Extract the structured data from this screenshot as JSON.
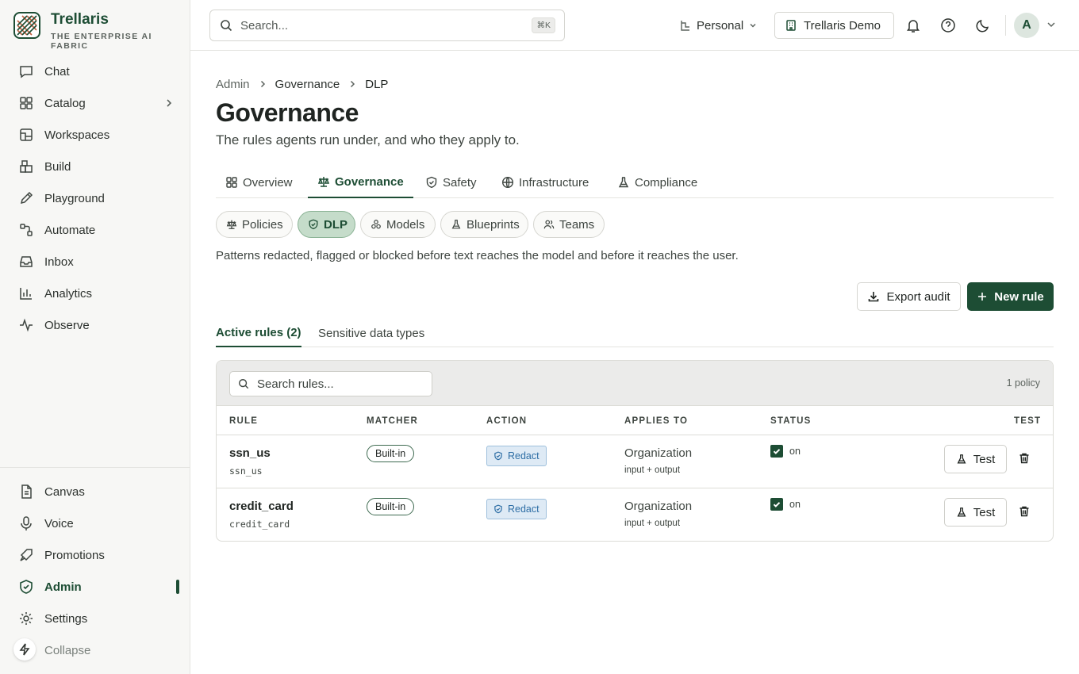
{
  "brand": {
    "name": "Trellaris",
    "tagline": "THE ENTERPRISE AI FABRIC",
    "accent": "#1d4d34"
  },
  "sidebar": {
    "items": [
      {
        "label": "Chat",
        "icon": "chat-bubble-icon"
      },
      {
        "label": "Catalog",
        "icon": "grid-icon",
        "has_submenu": true
      },
      {
        "label": "Workspaces",
        "icon": "workspaces-icon"
      },
      {
        "label": "Build",
        "icon": "blocks-icon"
      },
      {
        "label": "Playground",
        "icon": "pencil-icon"
      },
      {
        "label": "Automate",
        "icon": "workflow-icon"
      },
      {
        "label": "Inbox",
        "icon": "inbox-icon"
      },
      {
        "label": "Analytics",
        "icon": "bar-chart-icon"
      },
      {
        "label": "Observe",
        "icon": "activity-icon"
      }
    ],
    "bottom_items": [
      {
        "label": "Canvas",
        "icon": "document-icon"
      },
      {
        "label": "Voice",
        "icon": "microphone-icon"
      },
      {
        "label": "Promotions",
        "icon": "rocket-icon"
      },
      {
        "label": "Admin",
        "icon": "shield-icon",
        "active": true
      },
      {
        "label": "Settings",
        "icon": "gear-icon"
      },
      {
        "label": "Collapse",
        "icon": "bolt-icon"
      }
    ]
  },
  "topbar": {
    "search_placeholder": "Search...",
    "search_shortcut": "⌘K",
    "workspace_label": "Personal",
    "org_label": "Trellaris Demo",
    "avatar_initial": "A"
  },
  "breadcrumb": [
    "Admin",
    "Governance",
    "DLP"
  ],
  "page": {
    "title": "Governance",
    "subtitle": "The rules agents run under, and who they apply to."
  },
  "tabs": [
    {
      "label": "Overview",
      "icon": "grid-icon"
    },
    {
      "label": "Governance",
      "icon": "scale-icon",
      "active": true
    },
    {
      "label": "Safety",
      "icon": "shield-check-icon"
    },
    {
      "label": "Infrastructure",
      "icon": "globe-icon"
    },
    {
      "label": "Compliance",
      "icon": "flask-icon"
    }
  ],
  "pills": [
    {
      "label": "Policies",
      "icon": "scale-icon"
    },
    {
      "label": "DLP",
      "icon": "shield-check-icon",
      "active": true
    },
    {
      "label": "Models",
      "icon": "models-icon"
    },
    {
      "label": "Blueprints",
      "icon": "flask-icon"
    },
    {
      "label": "Teams",
      "icon": "users-icon"
    }
  ],
  "description": "Patterns redacted, flagged or blocked before text reaches the model and before it reaches the user.",
  "actions": {
    "export_label": "Export audit",
    "new_rule_label": "New rule"
  },
  "subtabs": [
    {
      "label": "Active rules (2)",
      "active": true
    },
    {
      "label": "Sensitive data types"
    }
  ],
  "rules_table": {
    "search_placeholder": "Search rules...",
    "count_label": "1 policy",
    "columns": [
      "RULE",
      "MATCHER",
      "ACTION",
      "APPLIES TO",
      "STATUS",
      "TEST"
    ],
    "rows": [
      {
        "name": "ssn_us",
        "id": "ssn_us",
        "matcher": "Built-in",
        "action": "Redact",
        "applies_to": "Organization",
        "scope": "input + output",
        "status": "on",
        "enabled": true,
        "test_label": "Test"
      },
      {
        "name": "credit_card",
        "id": "credit_card",
        "matcher": "Built-in",
        "action": "Redact",
        "applies_to": "Organization",
        "scope": "input + output",
        "status": "on",
        "enabled": true,
        "test_label": "Test"
      }
    ]
  }
}
